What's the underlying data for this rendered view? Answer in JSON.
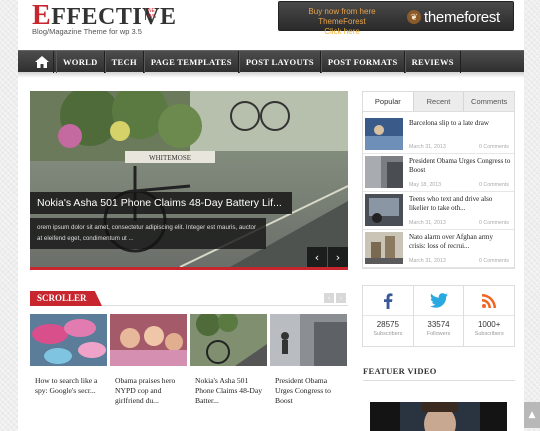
{
  "header": {
    "logo_first": "E",
    "logo_rest": "FFECTIVE",
    "logo_small": "NEWS",
    "tagline": "Blog/Magazine Theme for wp 3.5",
    "banner_line1": "Buy now from here ThemeForest",
    "banner_line2": "Click here",
    "banner_brand": "themeforest"
  },
  "nav": {
    "home_icon": "home-icon",
    "items": [
      "WORLD",
      "TECH",
      "PAGE TEMPLATES",
      "POST LAYOUTS",
      "POST FORMATS",
      "REVIEWS"
    ]
  },
  "slider": {
    "title": "Nokia's Asha 501 Phone Claims 48-Day Battery Lif...",
    "excerpt": "orem ipsum dolor sit amet, consectetur adipiscing elit. Integer est mauris, auctor at eleifend eget, condimentum ut ...",
    "sign_text": "WHITEMOSE",
    "prev": "‹",
    "next": "›"
  },
  "scroller": {
    "title": "SCROLLER",
    "prev": "‹",
    "next": "›",
    "items": [
      "How to search like a spy: Google's secr...",
      "Obama praises hero NYPD cop and girlfriend du...",
      "Nokia's Asha 501 Phone Claims 48-Day Batter...",
      "President Obama Urges Congress to Boost"
    ]
  },
  "tabs": {
    "labels": [
      "Popular",
      "Recent",
      "Comments"
    ],
    "items": [
      {
        "title": "Barcelona slip to a late draw",
        "date": "March 31, 2013",
        "comments": "0 Comments"
      },
      {
        "title": "President Obama Urges Congress to Boost",
        "date": "May 18, 2013",
        "comments": "0 Comments"
      },
      {
        "title": "Teens who text and drive also likelier to take oth...",
        "date": "March 31, 2013",
        "comments": "0 Comments"
      },
      {
        "title": "Nato alarm over Afghan army crisis: loss of recrui...",
        "date": "March 31, 2013",
        "comments": "0 Comments"
      }
    ]
  },
  "social": [
    {
      "icon": "facebook-icon",
      "count": "28575",
      "label": "Subscribers",
      "color": "#3b5998"
    },
    {
      "icon": "twitter-icon",
      "count": "33574",
      "label": "Followers",
      "color": "#2aa9e0"
    },
    {
      "icon": "rss-icon",
      "count": "1000+",
      "label": "Subscribers",
      "color": "#f26522"
    }
  ],
  "featured_video": {
    "title": "FEATUER VIDEO"
  },
  "colors": {
    "accent": "#c8262f",
    "nav_bg": "#3a3a3a"
  }
}
